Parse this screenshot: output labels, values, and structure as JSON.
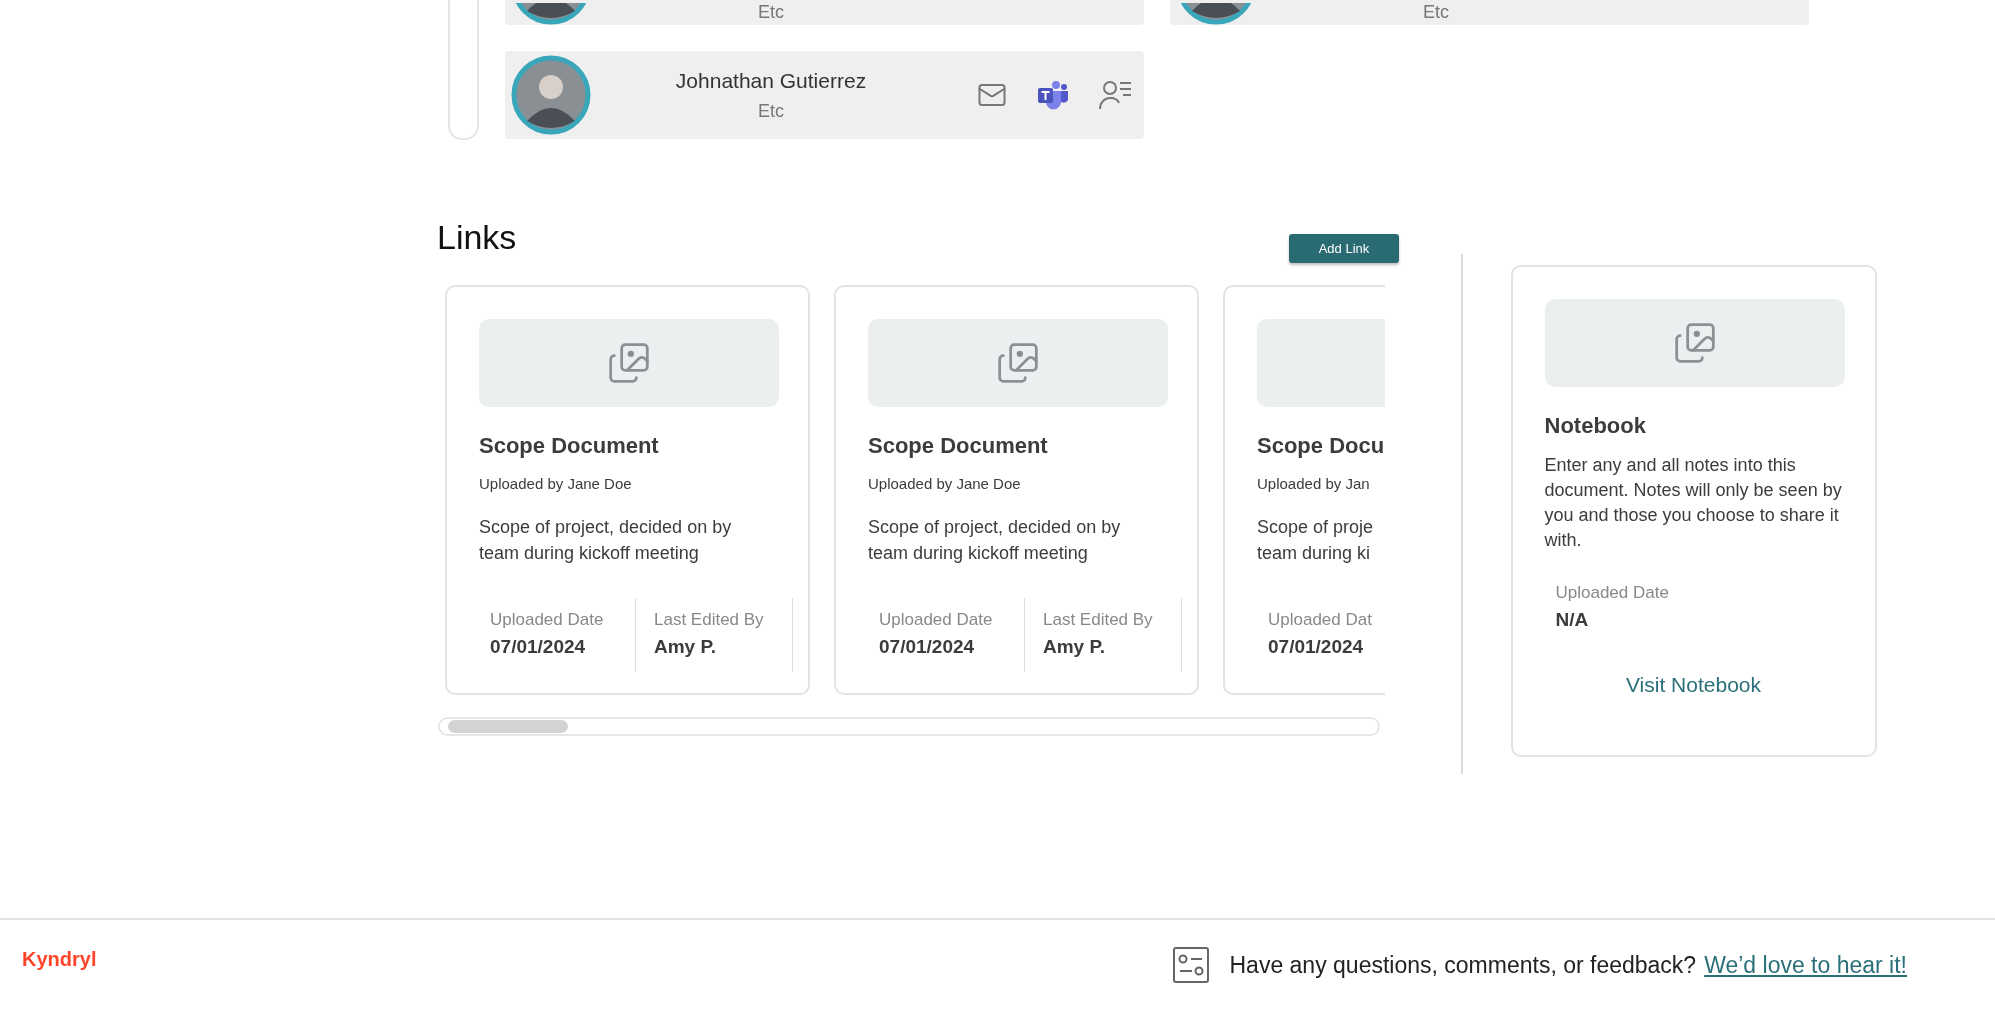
{
  "contacts": [
    {
      "kind": "cut",
      "role": "Etc"
    },
    {
      "kind": "cut",
      "role": "Etc"
    },
    {
      "kind": "full",
      "name": "Johnathan Gutierrez",
      "role": "Etc"
    }
  ],
  "links": {
    "heading": "Links",
    "add_button": "Add Link",
    "cards": [
      {
        "kind": "full",
        "title": "Scope Document",
        "uploader": "Uploaded by Jane Doe",
        "description": [
          "Scope of project, decided on by",
          "team during kickoff meeting"
        ],
        "meta": [
          {
            "label": "Uploaded Date",
            "value": "07/01/2024"
          },
          {
            "label": "Last Edited By",
            "value": "Amy P."
          }
        ]
      },
      {
        "kind": "full",
        "title": "Scope Document",
        "uploader": "Uploaded by Jane Doe",
        "description": [
          "Scope of project, decided on by",
          "team during kickoff meeting"
        ],
        "meta": [
          {
            "label": "Uploaded Date",
            "value": "07/01/2024"
          },
          {
            "label": "Last Edited By",
            "value": "Amy P."
          }
        ]
      },
      {
        "kind": "cut",
        "title": "Scope Docu",
        "uploader": "Uploaded by Jan",
        "description": [
          "Scope of proje",
          "team during ki"
        ],
        "meta": [
          {
            "label": "Uploaded Dat",
            "value": "07/01/2024"
          }
        ]
      }
    ]
  },
  "notebook": {
    "title": "Notebook",
    "description": "Enter any and all notes into this document. Notes will only be seen by you and those you choose to share it with.",
    "meta": {
      "label": "Uploaded Date",
      "value": "N/A"
    },
    "link": "Visit Notebook"
  },
  "footer": {
    "brand": "Kyndryl",
    "feedback": "Have any questions, comments, or feedback?",
    "link": "We’d love to hear it!"
  }
}
